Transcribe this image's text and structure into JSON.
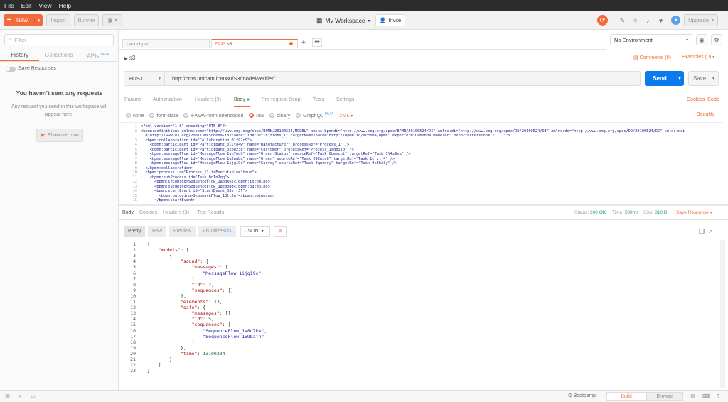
{
  "menu": [
    "File",
    "Edit",
    "View",
    "Help"
  ],
  "toolbar": {
    "new_label": "New",
    "import_label": "Import",
    "runner_label": "Runner",
    "workspace_label": "My Workspace",
    "invite_label": "Invite",
    "upgrade_label": "Upgrade"
  },
  "sidebar": {
    "filter_placeholder": "Filter",
    "tabs": [
      "History",
      "Collections",
      "APIs"
    ],
    "apis_badge": "BETA",
    "save_responses": "Save Responses",
    "empty_title": "You haven't sent any requests",
    "empty_desc": "Any request you send in this workspace will appear here.",
    "show_me": "Show me how"
  },
  "request_tabs": [
    {
      "label": "Launchpad"
    },
    {
      "method": "POST",
      "label": "s3"
    }
  ],
  "environment": "No Environment",
  "request": {
    "name": "s3",
    "comments": "Comments (0)",
    "examples": "Examples (0)",
    "method": "POST",
    "url": "http://pros.unicam.it:8080/S3/model/verifier/",
    "send": "Send",
    "save": "Save",
    "tabs": [
      "Params",
      "Authorization",
      "Headers (9)",
      "Body",
      "Pre-request Script",
      "Tests",
      "Settings"
    ],
    "cookies": "Cookies",
    "code": "Code",
    "body_types": [
      "none",
      "form-data",
      "x-www-form-urlencoded",
      "raw",
      "binary",
      "GraphQL"
    ],
    "graphql_badge": "BETA",
    "raw_format": "XML",
    "beautify": "Beautify",
    "body_lines": [
      "<?xml version=\"1.0\" encoding=\"UTF-8\"?>",
      "<bpmn:definitions xmlns:bpmn=\"http://www.omg.org/spec/BPMN/20100524/MODEL\" xmlns:bpmndi=\"http://www.omg.org/spec/BPMN/20100524/DI\" xmlns:di=\"http://www.omg.org/spec/DD/20100524/DI\" xmlns:dc=\"http://www.omg.org/spec/DD/20100524/DC\" xmlns:xsi",
      "  =\"http://www.w3.org/2001/XMLSchema-instance\" id=\"Definitions_1\" targetNamespace=\"http://bpmn.io/schema/bpmn\" exporter=\"Camunda Modeler\" exporterVersion=\"1.11.3\">",
      "  <bpmn:collaboration id=\"Collaboration_01f92r9\">",
      "    <bpmn:participant id=\"Participant_0llto4w\" name=\"Manufacturer\" processRef=\"Process_1\" />",
      "    <bpmn:participant id=\"Participant_02bgz38\" name=\"Customer\" processRef=\"Process_1sgbij0\" />",
      "    <bpmn:messageFlow id=\"MessageFlow_1uh7ooh\" name=\"Order Status\" sourceRef=\"Task_0bmmcnt\" targetRef=\"Task_1l4z9xu\" />",
      "    <bpmn:messageFlow id=\"MessageFlow_1u2wabq\" name=\"Order\" sourceRef=\"Task_092wzu6\" targetRef=\"Task_1crztj4\" />",
      "    <bpmn:messageFlow id=\"MessageFlow_1ijg19c\" name=\"Survey\" sourceRef=\"Task_0quznry\" targetRef=\"Task_0c5bz3y\" />",
      "  </bpmn:collaboration>",
      "  <bpmn:process id=\"Process_1\" isExecutable=\"true\">",
      "    <bpmn:subProcess id=\"Task_0q1n2qq\">",
      "      <bpmn:incoming>SequenceFlow_1apgk62</bpmn:incoming>",
      "      <bpmn:outgoing>SequenceFlow_18eqodg</bpmn:outgoing>",
      "      <bpmn:startEvent id=\"StartEvent_03sjr3l\">",
      "        <bpmn:outgoing>SequenceFlow_13lc5qf</bpmn:outgoing>",
      "      </bpmn:startEvent>"
    ],
    "body_line_numbers": [
      "1",
      "2",
      "",
      "3",
      "4",
      "5",
      "6",
      "7",
      "8",
      "9",
      "10",
      "11",
      "12",
      "13",
      "14",
      "15",
      "16"
    ]
  },
  "response": {
    "tabs": [
      "Body",
      "Cookies",
      "Headers (3)",
      "Test Results"
    ],
    "status_label": "Status:",
    "status_value": "200 OK",
    "time_label": "Time:",
    "time_value": "500ms",
    "size_label": "Size:",
    "size_value": "310 B",
    "save_response": "Save Response",
    "view_modes": [
      "Pretty",
      "Raw",
      "Preview",
      "Visualize"
    ],
    "visualize_badge": "BETA",
    "format": "JSON",
    "json_lines": [
      "{",
      "    \"models\": [",
      "        {",
      "            \"sound\": {",
      "                \"messages\": [",
      "                    \"MessageFlow_1ijg19c\"",
      "                ],",
      "                \"id\": 2,",
      "                \"sequences\": []",
      "            },",
      "            \"elements\": 13,",
      "            \"safe\": {",
      "                \"messages\": [],",
      "                \"id\": 5,",
      "                \"sequences\": [",
      "                    \"SequenceFlow_1v8d7kw\",",
      "                    \"SequenceFlow_159bajn\"",
      "                ]",
      "            },",
      "            \"time\": 13100334",
      "        }",
      "    ]",
      "}"
    ]
  },
  "statusbar": {
    "bootcamp": "Bootcamp",
    "build": "Build",
    "browse": "Browse"
  },
  "colors": {
    "accent": "#f26b3a",
    "send": "#097bed",
    "status_ok": "#2fa05e"
  }
}
